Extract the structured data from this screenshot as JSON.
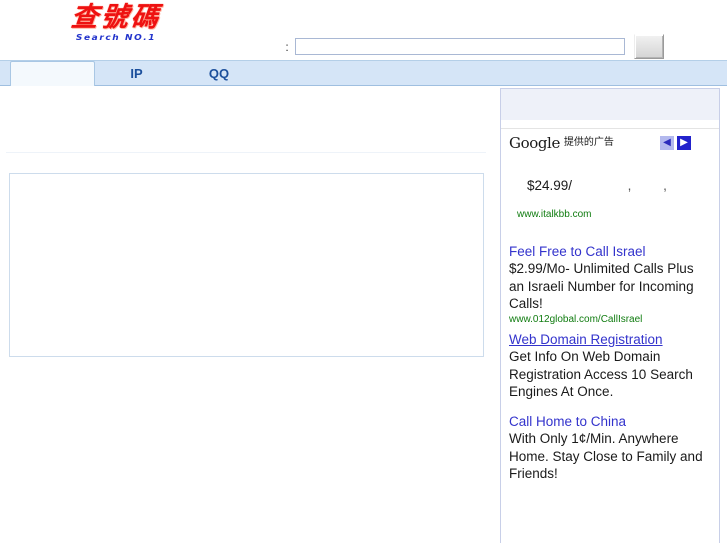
{
  "header": {
    "logo_cjk": "查號碼",
    "logo_sub": "Search NO.1",
    "search_label": ":",
    "search_value": "",
    "search_placeholder": "",
    "search_button_label": ""
  },
  "tabs": [
    {
      "label": "",
      "active": true
    },
    {
      "label": "IP",
      "active": false
    },
    {
      "label": "QQ",
      "active": false
    }
  ],
  "sidebar": {
    "brand": "Google",
    "by_label": "提供的广告",
    "prev_icon": "◀",
    "next_icon": "▶",
    "ads": [
      {
        "title": "",
        "price": "$24.99/",
        "ghost": ", ,",
        "body": "",
        "url": "www.italkbb.com"
      },
      {
        "title": "Feel Free to Call Israel",
        "body": "$2.99/Mo- Unlimited Calls Plus an Israeli Number for Incoming Calls!",
        "url": "www.012global.com/CallIsrael"
      },
      {
        "title": "Web Domain Registration",
        "body": "Get Info On Web Domain Registration Access 10 Search Engines At Once.",
        "url": ""
      },
      {
        "title": "Call Home to China",
        "body": "With Only 1¢/Min. Anywhere Home. Stay Close to Family and Friends!",
        "url": ""
      }
    ]
  },
  "colors": {
    "logo_red": "#ee1111",
    "logo_blue": "#2233cc",
    "tab_bar": "#d5e5f7",
    "tab_text": "#1b4f9c",
    "ad_link": "#3333cc",
    "ad_url_green": "#107c10",
    "next_arrow_bg": "#2222cc",
    "prev_arrow_bg": "#b3b9ee",
    "box_border": "#cddcec"
  }
}
